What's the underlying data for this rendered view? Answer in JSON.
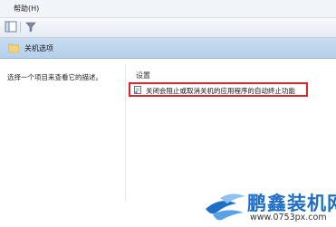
{
  "menubar": {
    "help_label": "帮助(H)"
  },
  "nav": {
    "title": "关机选项"
  },
  "left_pane": {
    "description": "选择一个项目来查看它的描述。"
  },
  "settings": {
    "column_header": "设置",
    "items": [
      {
        "label": "关闭会阻止或取消关机的应用程序的自动终止功能"
      }
    ]
  },
  "watermark": {
    "brand": "鹏鑫装机网",
    "url": "www.0753px.com"
  },
  "colors": {
    "highlight_border": "#e0262a",
    "brand_blue": "#1f6fc6"
  }
}
